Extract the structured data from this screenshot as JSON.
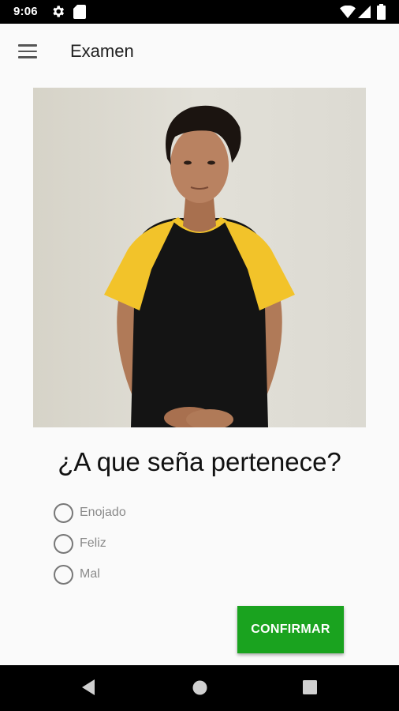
{
  "status_bar": {
    "time": "9:06",
    "left_icons": [
      "gear-icon",
      "sd-card-icon"
    ],
    "right_icons": [
      "wifi-icon",
      "signal-icon",
      "battery-icon"
    ]
  },
  "app_bar": {
    "title": "Examen",
    "menu_icon": "hamburger-menu-icon"
  },
  "exam": {
    "question": "¿A que seña pertenece?",
    "options": [
      {
        "label": "Enojado",
        "selected": false
      },
      {
        "label": "Feliz",
        "selected": false
      },
      {
        "label": "Mal",
        "selected": false
      }
    ],
    "confirm_label": "CONFIRMAR"
  },
  "colors": {
    "accent": "#1aa31f",
    "status_bar": "#000000",
    "background": "#fafafa"
  },
  "nav_bar": {
    "buttons": [
      "back-icon",
      "home-icon",
      "recents-icon"
    ]
  }
}
